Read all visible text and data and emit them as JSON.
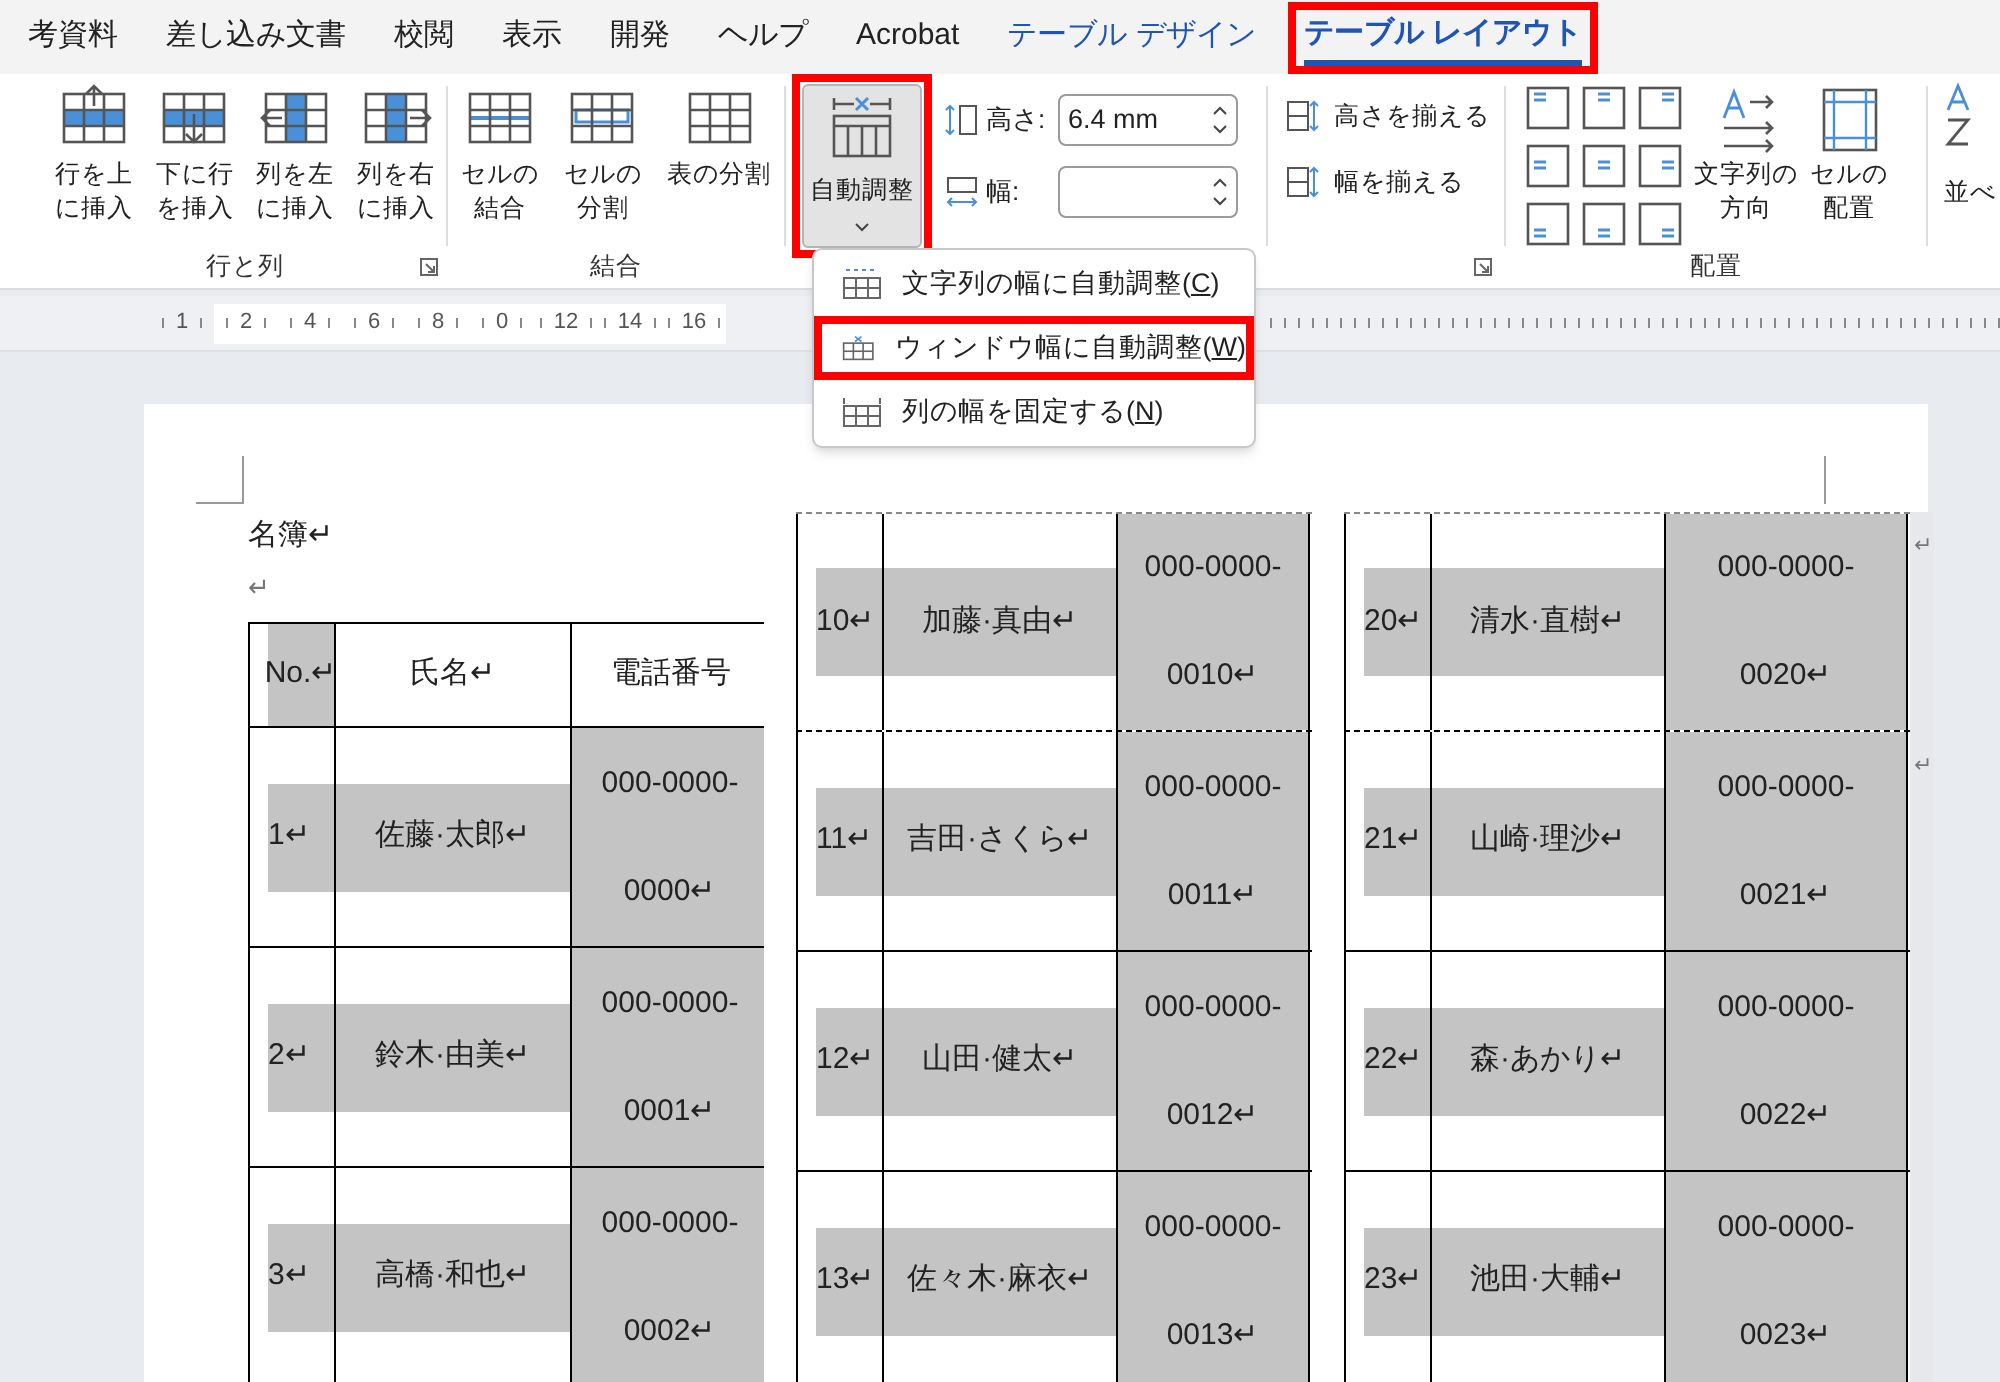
{
  "ribbon_tabs": [
    {
      "label": "考資料",
      "selected": false,
      "contextual": false,
      "annotated": false
    },
    {
      "label": "差し込み文書",
      "selected": false,
      "contextual": false,
      "annotated": false
    },
    {
      "label": "校閲",
      "selected": false,
      "contextual": false,
      "annotated": false
    },
    {
      "label": "表示",
      "selected": false,
      "contextual": false,
      "annotated": false
    },
    {
      "label": "開発",
      "selected": false,
      "contextual": false,
      "annotated": false
    },
    {
      "label": "ヘルプ",
      "selected": false,
      "contextual": false,
      "annotated": false
    },
    {
      "label": "Acrobat",
      "selected": false,
      "contextual": false,
      "annotated": false
    },
    {
      "label": "テーブル デザイン",
      "selected": false,
      "contextual": true,
      "annotated": false
    },
    {
      "label": "テーブル レイアウト",
      "selected": true,
      "contextual": true,
      "annotated": true
    }
  ],
  "rows_columns": {
    "label": "行と列",
    "buttons": [
      {
        "kind": "insert_above",
        "lines": [
          "行を上",
          "に挿入"
        ]
      },
      {
        "kind": "insert_below",
        "lines": [
          "下に行",
          "を挿入"
        ]
      },
      {
        "kind": "insert_left",
        "lines": [
          "列を左",
          "に挿入"
        ]
      },
      {
        "kind": "insert_right",
        "lines": [
          "列を右",
          "に挿入"
        ]
      }
    ]
  },
  "merge": {
    "label": "結合",
    "buttons": [
      {
        "kind": "merge",
        "lines": [
          "セルの",
          "結合"
        ]
      },
      {
        "kind": "split",
        "lines": [
          "セルの",
          "分割"
        ]
      },
      {
        "kind": "split_table",
        "lines": [
          "表の分割"
        ]
      }
    ]
  },
  "autofit": {
    "label": "自動調整",
    "annotated": true,
    "expanded": true
  },
  "cell_size": {
    "height": {
      "label": "高さ:",
      "value": "6.4 mm"
    },
    "width": {
      "label": "幅:"
    }
  },
  "distribute": [
    "高さを揃える",
    "幅を揃える"
  ],
  "alignment": {
    "label": "配置",
    "direction": [
      "文字列の",
      "方向"
    ],
    "cell_margins": [
      "セルの",
      "配置"
    ]
  },
  "sort": {
    "label": "並べ"
  },
  "autofit_menu": {
    "items": [
      {
        "kind": "contents",
        "text": "文字列の幅に自動調整(",
        "access_key": "C",
        "text_after": ")",
        "annotated": false
      },
      {
        "kind": "window",
        "text": "ウィンドウ幅に自動調整(",
        "access_key": "W",
        "text_after": ")",
        "annotated": true
      },
      {
        "kind": "fixed",
        "text": "列の幅を固定する(",
        "access_key": "N",
        "text_after": ")",
        "annotated": false
      }
    ]
  },
  "ruler": {
    "labels": [
      "1",
      "2",
      "4",
      "6",
      "8",
      "0",
      "12",
      "14",
      "16"
    ]
  },
  "document": {
    "title": "名簿↵",
    "empty_paragraph": "↵",
    "tables": [
      {
        "header": [
          "No.↵",
          "氏名↵",
          "電話番号"
        ],
        "rows": [
          {
            "number": "1↵",
            "name": "佐藤·太郎↵",
            "phone_line_1": "000-0000-",
            "phone_line_2": "0000↵"
          },
          {
            "number": "2↵",
            "name": "鈴木·由美↵",
            "phone_line_1": "000-0000-",
            "phone_line_2": "0001↵"
          },
          {
            "number": "3↵",
            "name": "高橋·和也↵",
            "phone_line_1": "000-0000-",
            "phone_line_2": "0002↵"
          }
        ]
      },
      {
        "rows": [
          {
            "number": "10↵",
            "name": "加藤·真由↵",
            "phone_line_1": "000-0000-",
            "phone_line_2": "0010↵"
          },
          {
            "number": "11↵",
            "name": "吉田·さくら↵",
            "phone_line_1": "000-0000-",
            "phone_line_2": "0011↵"
          },
          {
            "number": "12↵",
            "name": "山田·健太↵",
            "phone_line_1": "000-0000-",
            "phone_line_2": "0012↵"
          },
          {
            "number": "13↵",
            "name": "佐々木·麻衣↵",
            "phone_line_1": "000-0000-",
            "phone_line_2": "0013↵"
          }
        ]
      },
      {
        "rows": [
          {
            "number": "20↵",
            "name": "清水·直樹↵",
            "phone_line_1": "000-0000-",
            "phone_line_2": "0020↵",
            "end_mark": "↵"
          },
          {
            "number": "21↵",
            "name": "山崎·理沙↵",
            "phone_line_1": "000-0000-",
            "phone_line_2": "0021↵",
            "end_mark": "↵"
          },
          {
            "number": "22↵",
            "name": "森·あかり↵",
            "phone_line_1": "000-0000-",
            "phone_line_2": "0022↵"
          },
          {
            "number": "23↵",
            "name": "池田·大輔↵",
            "phone_line_1": "000-0000-",
            "phone_line_2": "0023↵"
          }
        ]
      }
    ]
  }
}
